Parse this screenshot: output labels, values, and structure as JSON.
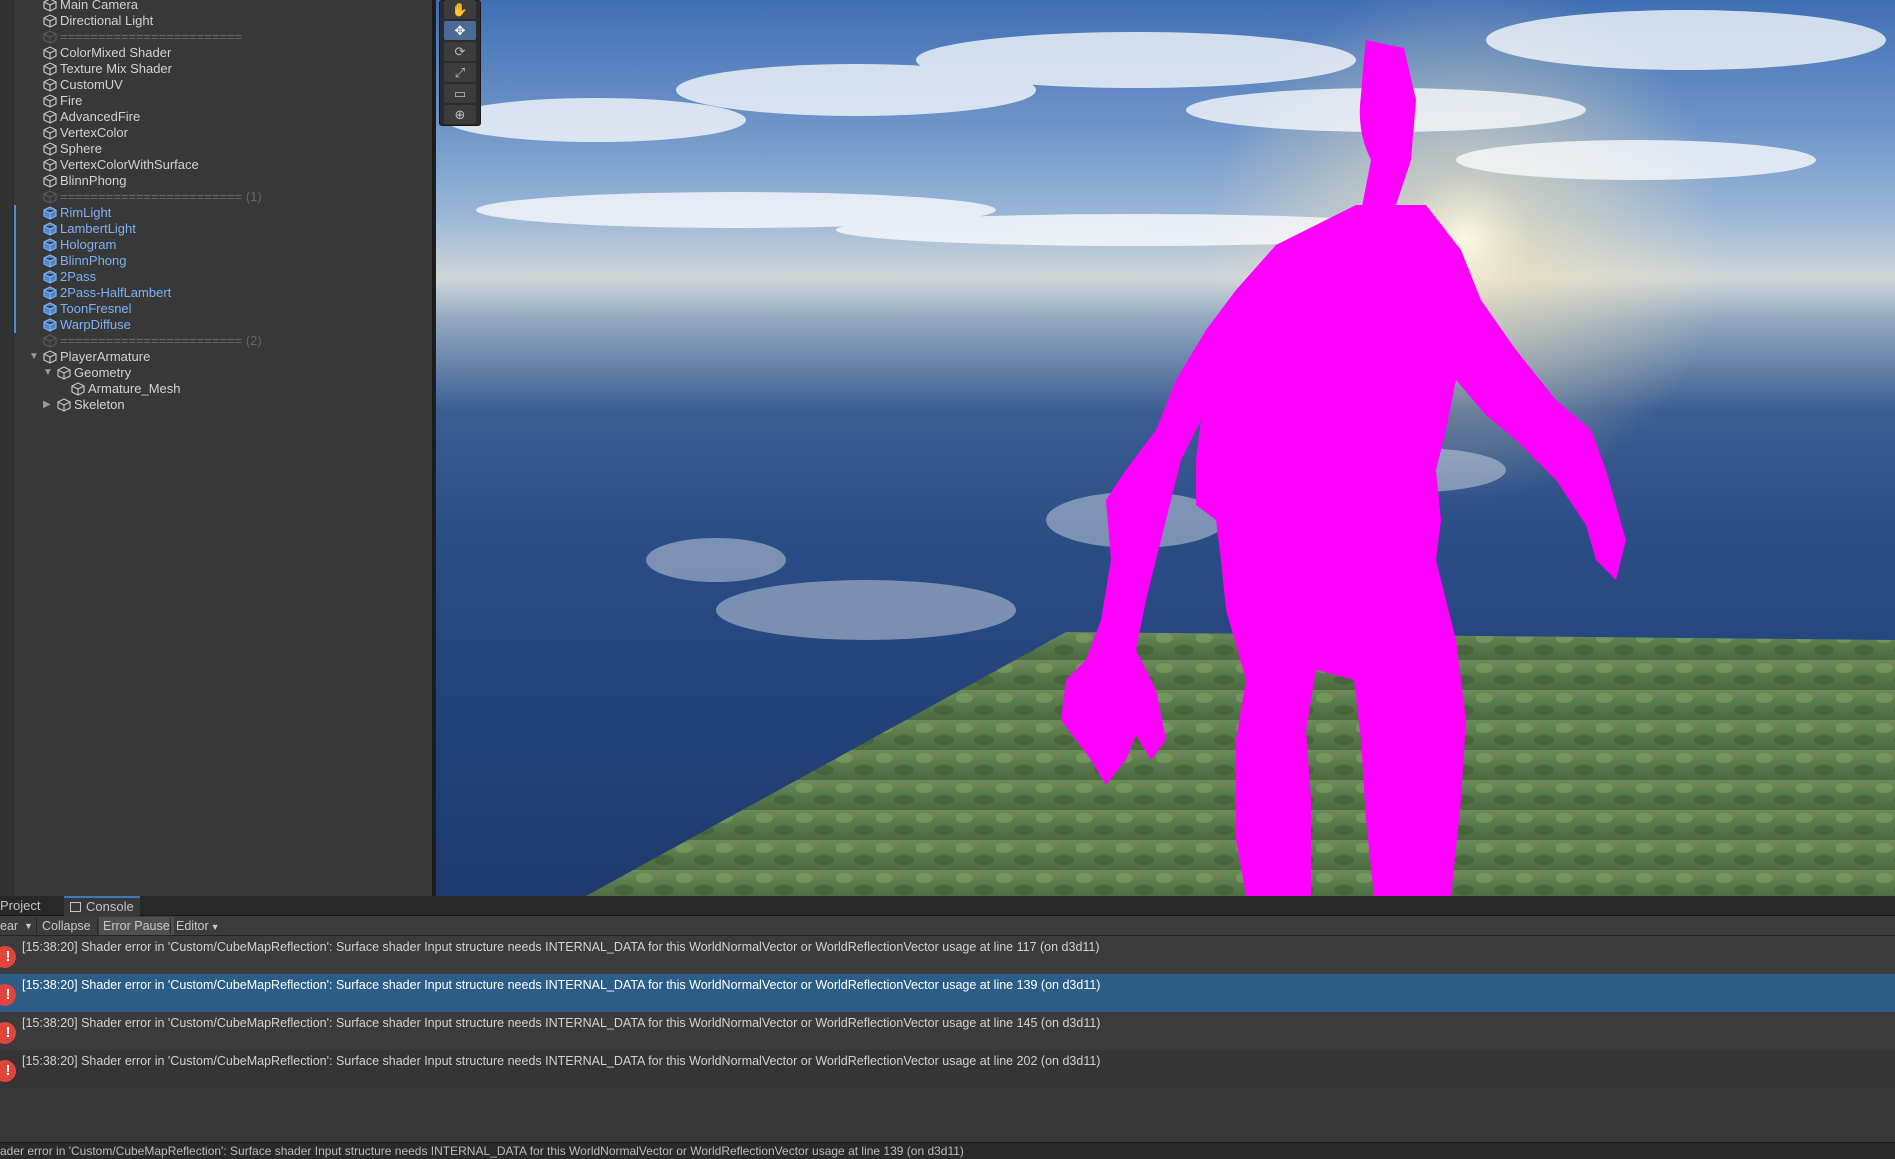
{
  "hierarchy": {
    "items": [
      {
        "label": "Main Camera",
        "kind": "object"
      },
      {
        "label": "Directional Light",
        "kind": "object"
      },
      {
        "label": "========================",
        "kind": "sep"
      },
      {
        "label": "ColorMixed Shader",
        "kind": "object"
      },
      {
        "label": "Texture Mix Shader",
        "kind": "object"
      },
      {
        "label": "CustomUV",
        "kind": "object"
      },
      {
        "label": "Fire",
        "kind": "object"
      },
      {
        "label": "AdvancedFire",
        "kind": "object"
      },
      {
        "label": "VertexColor",
        "kind": "object"
      },
      {
        "label": "Sphere",
        "kind": "object"
      },
      {
        "label": "VertexColorWithSurface",
        "kind": "object"
      },
      {
        "label": "BlinnPhong",
        "kind": "object"
      },
      {
        "label": "======================== (1)",
        "kind": "sep"
      },
      {
        "label": "RimLight",
        "kind": "prefab"
      },
      {
        "label": "LambertLight",
        "kind": "prefab"
      },
      {
        "label": "Hologram",
        "kind": "prefab"
      },
      {
        "label": "BlinnPhong",
        "kind": "prefab"
      },
      {
        "label": "2Pass",
        "kind": "prefab"
      },
      {
        "label": "2Pass-HalfLambert",
        "kind": "prefab"
      },
      {
        "label": "ToonFresnel",
        "kind": "prefab"
      },
      {
        "label": "WarpDiffuse",
        "kind": "prefab"
      },
      {
        "label": "======================== (2)",
        "kind": "sep"
      },
      {
        "label": "PlayerArmature",
        "kind": "object",
        "expanded": true
      },
      {
        "label": "Geometry",
        "kind": "object",
        "expanded": true
      },
      {
        "label": "Armature_Mesh",
        "kind": "object"
      },
      {
        "label": "Skeleton",
        "kind": "object",
        "expanded": false
      }
    ]
  },
  "scene": {
    "tools": [
      "hand-tool",
      "move-tool",
      "rotate-tool",
      "scale-tool",
      "rect-tool",
      "transform-tool"
    ],
    "active_tool": "move-tool",
    "character_color": "#ff00ff"
  },
  "bottom_panel": {
    "tabs": [
      {
        "label": "Project"
      },
      {
        "label": "Console"
      }
    ],
    "active_tab": "Console",
    "toolbar": {
      "clear": "ear",
      "collapse": "Collapse",
      "error_pause": "Error Pause",
      "editor": "Editor"
    }
  },
  "console": {
    "entries": [
      {
        "text": "[15:38:20] Shader error in 'Custom/CubeMapReflection': Surface shader Input structure needs INTERNAL_DATA for this WorldNormalVector or WorldReflectionVector usage at line 117 (on d3d11)",
        "selected": false
      },
      {
        "text": "[15:38:20] Shader error in 'Custom/CubeMapReflection': Surface shader Input structure needs INTERNAL_DATA for this WorldNormalVector or WorldReflectionVector usage at line 139 (on d3d11)",
        "selected": true
      },
      {
        "text": "[15:38:20] Shader error in 'Custom/CubeMapReflection': Surface shader Input structure needs INTERNAL_DATA for this WorldNormalVector or WorldReflectionVector usage at line 145 (on d3d11)",
        "selected": false
      },
      {
        "text": "[15:38:20] Shader error in 'Custom/CubeMapReflection': Surface shader Input structure needs INTERNAL_DATA for this WorldNormalVector or WorldReflectionVector usage at line 202 (on d3d11)",
        "selected": false
      }
    ],
    "error_color": "#e0453c",
    "selected_color": "#2c5d87"
  },
  "status": {
    "text": "ader error in 'Custom/CubeMapReflection': Surface shader Input structure needs INTERNAL_DATA for this WorldNormalVector or WorldReflectionVector usage at line 139 (on d3d11)"
  }
}
